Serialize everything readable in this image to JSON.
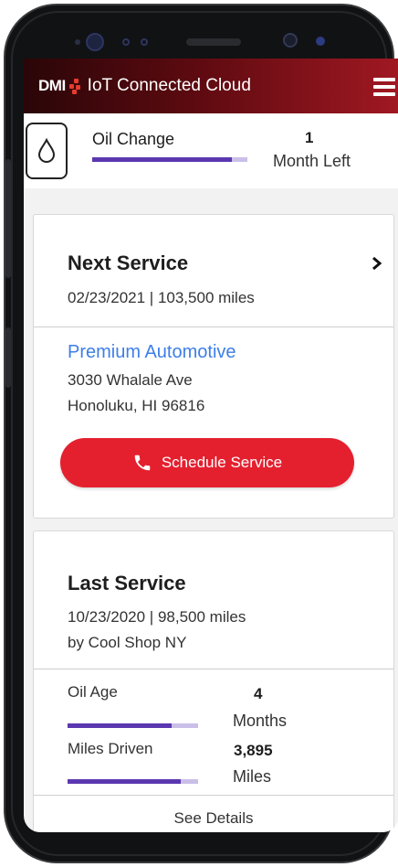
{
  "header": {
    "brand_short": "DMI",
    "brand_title": "IoT Connected Cloud",
    "menu_icon": "hamburger-menu-icon"
  },
  "oil_change": {
    "icon": "oil-drop-icon",
    "label": "Oil Change",
    "count": "1",
    "unit": "Month Left",
    "progress": 0.9
  },
  "next_service": {
    "title": "Next Service",
    "date_miles": "02/23/2021 | 103,500 miles",
    "shop_name": "Premium Automotive",
    "address_line1": "3030 Whalale Ave",
    "address_line2": "Honoluku, HI 96816",
    "schedule_label": "Schedule Service",
    "schedule_icon": "phone-icon",
    "chevron_icon": "chevron-right-icon"
  },
  "last_service": {
    "title": "Last Service",
    "date_miles": "10/23/2020 | 98,500 miles",
    "by_shop": "by Cool Shop NY",
    "oil_age": {
      "label": "Oil Age",
      "value": "4",
      "unit": "Months",
      "progress": 0.8
    },
    "miles_driven": {
      "label": "Miles Driven",
      "value": "3,895",
      "unit": "Miles",
      "progress": 0.87
    },
    "see_details": "See Details"
  },
  "colors": {
    "accent_red": "#e4202f",
    "progress_purple": "#5b37b0",
    "progress_track": "#c9bfe8",
    "link_blue": "#3d7ee8"
  }
}
